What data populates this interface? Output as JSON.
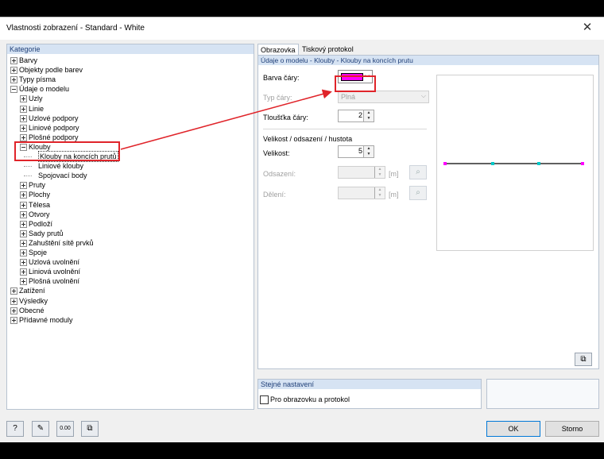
{
  "window": {
    "title": "Vlastnosti zobrazení - Standard - White",
    "close_icon": "close-icon"
  },
  "tree": {
    "header": "Kategorie",
    "items": [
      {
        "label": "Barvy",
        "level": 0,
        "exp": "plus"
      },
      {
        "label": "Objekty podle barev",
        "level": 0,
        "exp": "plus"
      },
      {
        "label": "Typy písma",
        "level": 0,
        "exp": "plus"
      },
      {
        "label": "Údaje o modelu",
        "level": 0,
        "exp": "minus"
      },
      {
        "label": "Uzly",
        "level": 1,
        "exp": "plus"
      },
      {
        "label": "Linie",
        "level": 1,
        "exp": "plus"
      },
      {
        "label": "Uzlové podpory",
        "level": 1,
        "exp": "plus"
      },
      {
        "label": "Liniové podpory",
        "level": 1,
        "exp": "plus"
      },
      {
        "label": "Plošné podpory",
        "level": 1,
        "exp": "plus"
      },
      {
        "label": "Klouby",
        "level": 1,
        "exp": "minus"
      },
      {
        "label": "Klouby na koncích prutů",
        "level": 2,
        "exp": "none",
        "selected": true
      },
      {
        "label": "Liniové klouby",
        "level": 2,
        "exp": "none"
      },
      {
        "label": "Spojovací body",
        "level": 2,
        "exp": "none"
      },
      {
        "label": "Pruty",
        "level": 1,
        "exp": "plus"
      },
      {
        "label": "Plochy",
        "level": 1,
        "exp": "plus"
      },
      {
        "label": "Tělesa",
        "level": 1,
        "exp": "plus"
      },
      {
        "label": "Otvory",
        "level": 1,
        "exp": "plus"
      },
      {
        "label": "Podloží",
        "level": 1,
        "exp": "plus"
      },
      {
        "label": "Sady prutů",
        "level": 1,
        "exp": "plus"
      },
      {
        "label": "Zahuštění sítě prvků",
        "level": 1,
        "exp": "plus"
      },
      {
        "label": "Spoje",
        "level": 1,
        "exp": "plus"
      },
      {
        "label": "Uzlová uvolnění",
        "level": 1,
        "exp": "plus"
      },
      {
        "label": "Liniová uvolnění",
        "level": 1,
        "exp": "plus"
      },
      {
        "label": "Plošná uvolnění",
        "level": 1,
        "exp": "plus"
      },
      {
        "label": "Zatížení",
        "level": 0,
        "exp": "plus"
      },
      {
        "label": "Výsledky",
        "level": 0,
        "exp": "plus"
      },
      {
        "label": "Obecné",
        "level": 0,
        "exp": "plus"
      },
      {
        "label": "Přídavné moduly",
        "level": 0,
        "exp": "plus"
      }
    ]
  },
  "tabs": [
    {
      "label": "Obrazovka",
      "active": true
    },
    {
      "label": "Tiskový protokol",
      "active": false
    }
  ],
  "section": {
    "title": "Údaje o modelu - Klouby - Klouby na koncích prutu",
    "line_color_label": "Barva čáry:",
    "line_color": "#ff00ff",
    "line_type_label": "Typ čáry:",
    "line_type_value": "Plná",
    "thickness_label": "Tloušťka čáry:",
    "thickness_value": "2",
    "group_title": "Velikost / odsazení / hustota",
    "size_label": "Velikost:",
    "size_value": "5",
    "offset_label": "Odsazení:",
    "offset_unit": "[m]",
    "division_label": "Dělení:",
    "division_unit": "[m]"
  },
  "same_settings": {
    "title": "Stejné nastavení",
    "checkbox_label": "Pro obrazovku a protokol",
    "checked": false
  },
  "buttons": {
    "ok": "OK",
    "cancel": "Storno"
  },
  "bottom_icons": [
    "help-icon",
    "edit-icon",
    "units-icon",
    "export-icon"
  ],
  "colors": {
    "annotation": "#e0242a",
    "preview_dot_end": "#ff00ff",
    "preview_dot_mid": "#00c8c8"
  }
}
